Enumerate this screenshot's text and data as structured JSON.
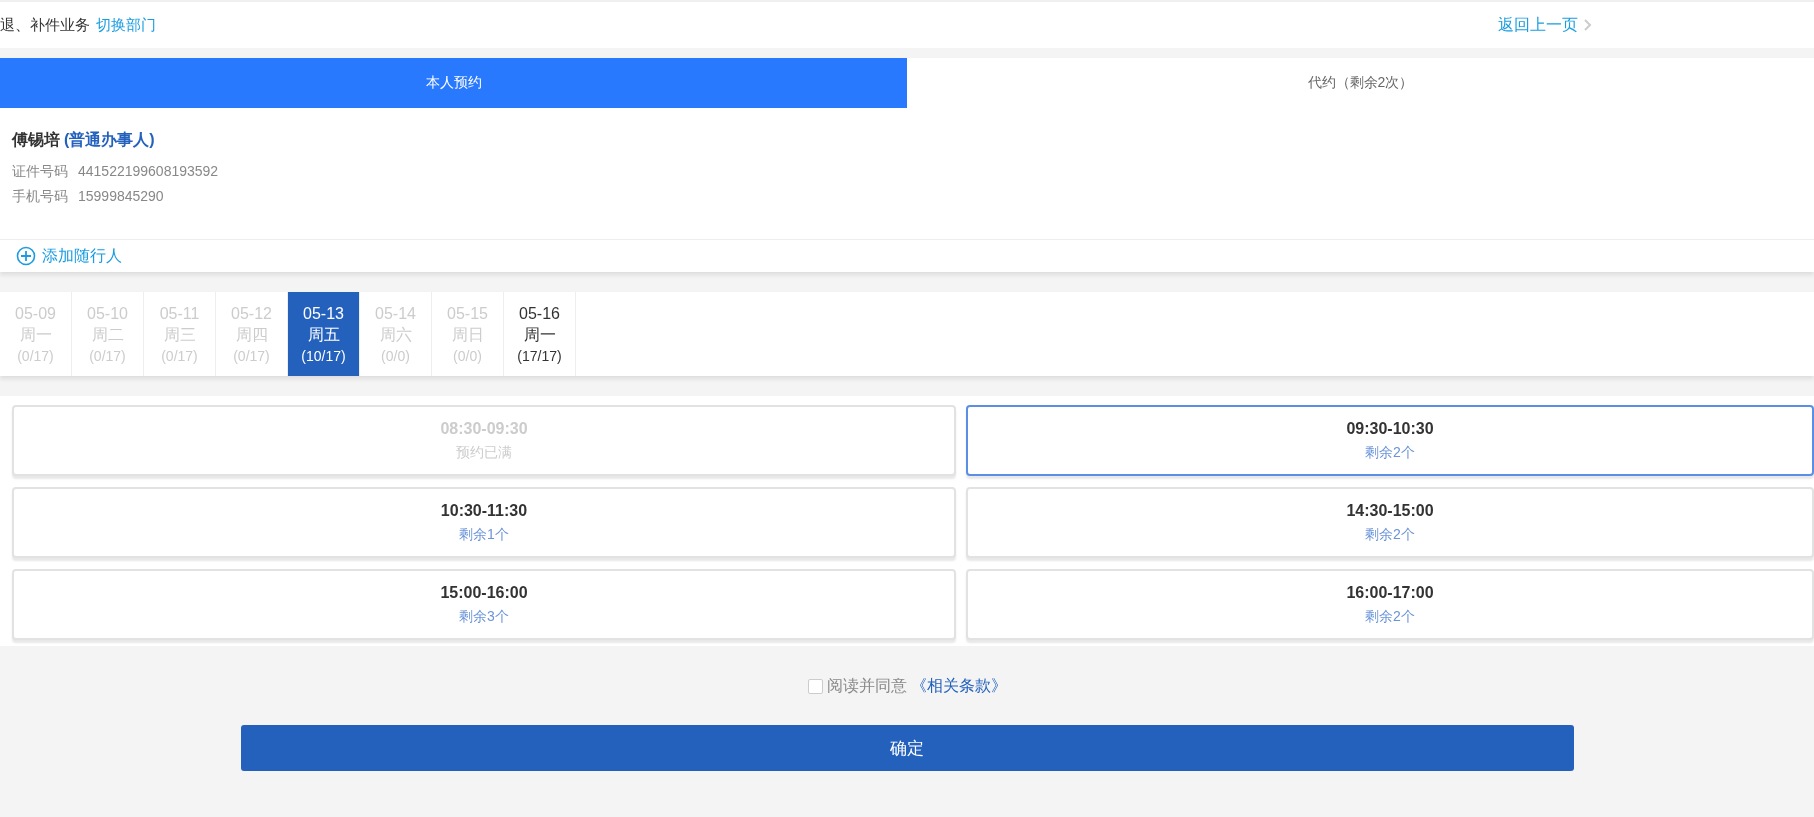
{
  "header": {
    "title": "退、补件业务",
    "switch_link": "切换部门",
    "back_link": "返回上一页"
  },
  "tabs": [
    {
      "label": "本人预约",
      "selected": true
    },
    {
      "label": "代约（剩余2次）",
      "selected": false
    }
  ],
  "applicant": {
    "name": "傅锡培",
    "role": "(普通办事人)",
    "fields": [
      {
        "label": "证件号码",
        "value": "441522199608193592"
      },
      {
        "label": "手机号码",
        "value": "15999845290"
      }
    ]
  },
  "add_companion": "添加随行人",
  "dates": [
    {
      "date": "05-09",
      "weekday": "周一",
      "count": "(0/17)",
      "disabled": true,
      "selected": false
    },
    {
      "date": "05-10",
      "weekday": "周二",
      "count": "(0/17)",
      "disabled": true,
      "selected": false
    },
    {
      "date": "05-11",
      "weekday": "周三",
      "count": "(0/17)",
      "disabled": true,
      "selected": false
    },
    {
      "date": "05-12",
      "weekday": "周四",
      "count": "(0/17)",
      "disabled": true,
      "selected": false
    },
    {
      "date": "05-13",
      "weekday": "周五",
      "count": "(10/17)",
      "disabled": false,
      "selected": true
    },
    {
      "date": "05-14",
      "weekday": "周六",
      "count": "(0/0)",
      "disabled": true,
      "selected": false
    },
    {
      "date": "05-15",
      "weekday": "周日",
      "count": "(0/0)",
      "disabled": true,
      "selected": false
    },
    {
      "date": "05-16",
      "weekday": "周一",
      "count": "(17/17)",
      "disabled": false,
      "selected": false
    }
  ],
  "slots": [
    {
      "time": "08:30-09:30",
      "status": "预约已满",
      "disabled": true,
      "selected": false
    },
    {
      "time": "09:30-10:30",
      "status": "剩余2个",
      "disabled": false,
      "selected": true
    },
    {
      "time": "10:30-11:30",
      "status": "剩余1个",
      "disabled": false,
      "selected": false
    },
    {
      "time": "14:30-15:00",
      "status": "剩余2个",
      "disabled": false,
      "selected": false
    },
    {
      "time": "15:00-16:00",
      "status": "剩余3个",
      "disabled": false,
      "selected": false
    },
    {
      "time": "16:00-17:00",
      "status": "剩余2个",
      "disabled": false,
      "selected": false
    }
  ],
  "agreement": {
    "checked": false,
    "text": "阅读并同意",
    "link": "《相关条款》"
  },
  "confirm_button": "确定"
}
